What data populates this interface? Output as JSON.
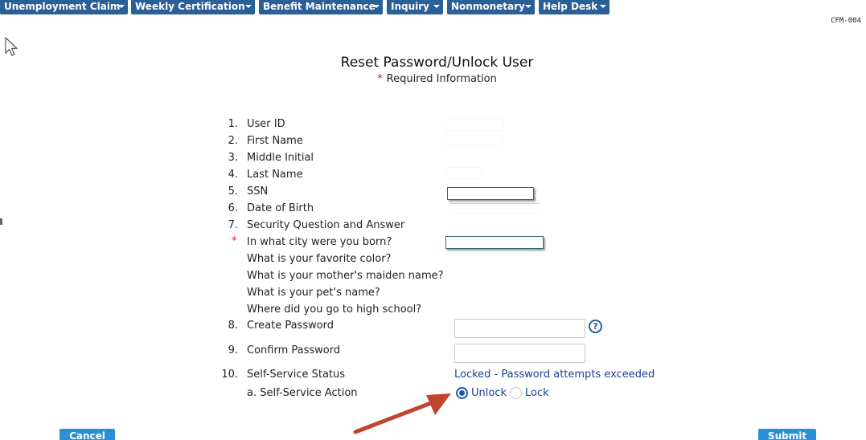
{
  "menu": {
    "items": [
      {
        "label": "Unemployment Claim"
      },
      {
        "label": "Weekly Certification"
      },
      {
        "label": "Benefit Maintenance"
      },
      {
        "label": "Inquiry"
      },
      {
        "label": "Nonmonetary"
      },
      {
        "label": "Help Desk"
      }
    ]
  },
  "screen_code": "CFM-004",
  "form": {
    "title": "Reset Password/Unlock User",
    "required_star": "*",
    "required_note": "Required Information",
    "rows": [
      {
        "num": "1.",
        "label": "User ID"
      },
      {
        "num": "2.",
        "label": "First Name"
      },
      {
        "num": "3.",
        "label": "Middle Initial"
      },
      {
        "num": "4.",
        "label": "Last Name"
      },
      {
        "num": "5.",
        "label": "SSN"
      },
      {
        "num": "6.",
        "label": "Date of Birth"
      },
      {
        "num": "7.",
        "label": "Security Question and Answer"
      },
      {
        "num": "8.",
        "label": "Create Password"
      },
      {
        "num": "9.",
        "label": "Confirm Password"
      },
      {
        "num": "10.",
        "label": "Self-Service Status"
      }
    ],
    "security_questions": [
      "In what city were you born?",
      "What is your favorite color?",
      "What is your mother's maiden name?",
      "What is your pet's name?",
      "Where did you go to high school?"
    ],
    "required_marker": "*",
    "self_service_status": "Locked - Password attempts exceeded",
    "self_service_action_label": "a. Self-Service Action",
    "action_options": [
      "Unlock",
      "Lock"
    ],
    "selected_action": "Unlock",
    "help_icon_glyph": "?"
  },
  "buttons": {
    "cancel": "Cancel",
    "submit": "Submit"
  },
  "icons": {
    "cursor": "mouse-pointer-icon",
    "help": "help-circle-icon",
    "menu_caret": "caret-down-icon"
  },
  "colors": {
    "menu_bg": "#2b5f97",
    "button_bg": "#2b8fd6",
    "required": "#d42020",
    "status_text": "#1c3f91",
    "arrow": "#c0452c"
  }
}
